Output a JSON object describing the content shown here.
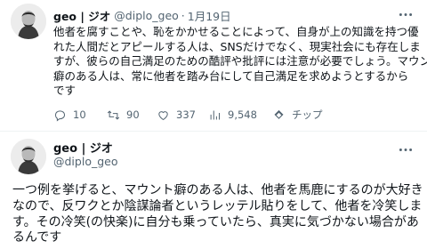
{
  "tweet1": {
    "name": "geo | ジオ",
    "handle": "@diplo_geo",
    "separator": "·",
    "date": "1月19日",
    "body_lines": [
      "他者を腐すことや、恥をかかせることによって、自身が上の知識を持つ優",
      "れた人間だとアピールする人は、SNSだけでなく、現実社会にも存在しま",
      "すが、彼らの自己満足のための酷評や批評には注意が必要でしょう。マウント",
      "癖のある人は、常に他者を踏み台にして自己満足を求めようとするから",
      "です"
    ],
    "actions": {
      "reply_count": "10",
      "retweet_count": "90",
      "like_count": "337",
      "view_count": "9,548",
      "tip_label": "チップ"
    },
    "icons": [
      "more-icon",
      "reply-icon",
      "retweet-icon",
      "like-icon",
      "views-icon",
      "tip-icon"
    ]
  },
  "tweet2": {
    "name": "geo | ジオ",
    "handle": "@diplo_geo",
    "body_lines": [
      "一つ例を挙げると、マウント癖のある人は、他者を馬鹿にするのが大好き",
      "なので、反ワクとか陰謀論者というレッテル貼りをして、他者を冷笑しま",
      "す。その冷笑(の快楽)に自分も乗っていたら、真実に気づかない場合があ",
      "るんです"
    ]
  },
  "colors": {
    "text_primary": "#0f1419",
    "text_secondary": "#536471",
    "divider": "#eff3f4"
  }
}
